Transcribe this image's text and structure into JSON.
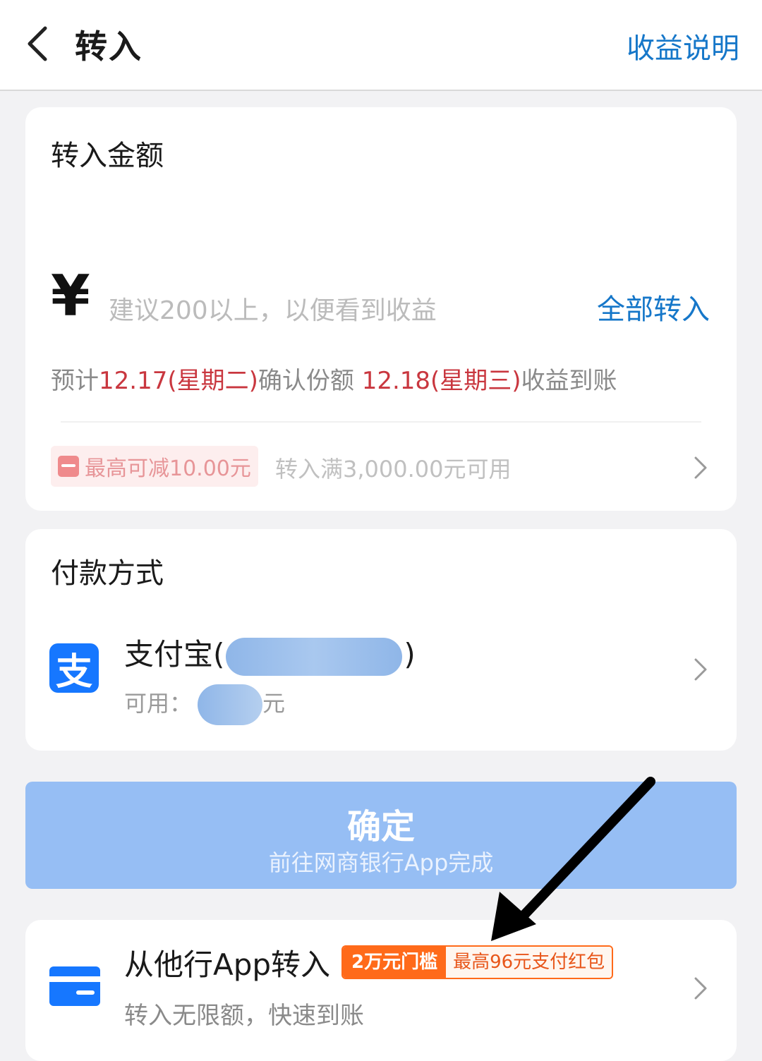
{
  "header": {
    "title": "转入",
    "right_link": "收益说明"
  },
  "amount_card": {
    "section_title": "转入金额",
    "currency_symbol": "¥",
    "input_placeholder": "建议200以上，以便看到收益",
    "input_value": "",
    "all_in_label": "全部转入",
    "estimate": {
      "prefix": "预计",
      "confirm_date": "12.17(星期二)",
      "confirm_text": "确认份额 ",
      "income_date": "12.18(星期三)",
      "income_text": "收益到账"
    },
    "coupon": {
      "label": "最高可减10.00元",
      "condition": "转入满3,000.00元可用"
    }
  },
  "payment_card": {
    "section_title": "付款方式",
    "method_name": "支付宝",
    "method_logo_glyph": "支",
    "open_paren": "(",
    "close_paren": ")",
    "available_prefix": "可用：",
    "available_suffix": "元"
  },
  "confirm_button": {
    "main_label": "确定",
    "sub_label": "前往网商银行App完成"
  },
  "other_bank": {
    "title": "从他行App转入",
    "badge_threshold": "2万元门槛",
    "badge_reward": "最高96元支付红包",
    "subtitle": "转入无限额，快速到账"
  },
  "colors": {
    "accent_blue": "#1677c9",
    "date_red": "#c9373f",
    "button_blue": "#96bef4",
    "badge_orange": "#ff6a1a"
  }
}
